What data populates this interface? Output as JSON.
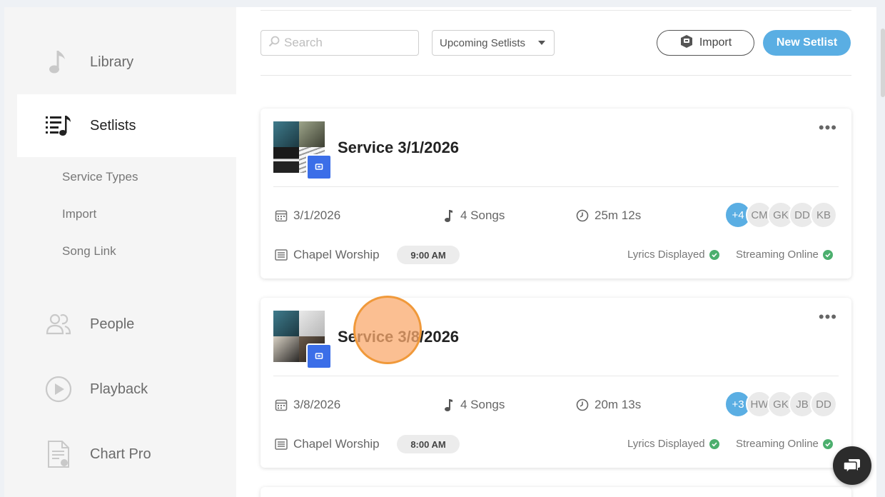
{
  "sidebar": {
    "items": [
      {
        "label": "Library",
        "icon": "music-note-icon"
      },
      {
        "label": "Setlists",
        "icon": "setlist-icon"
      },
      {
        "label": "People",
        "icon": "people-icon"
      },
      {
        "label": "Playback",
        "icon": "play-circle-icon"
      },
      {
        "label": "Chart Pro",
        "icon": "chart-document-icon"
      }
    ],
    "sub_items": [
      "Service Types",
      "Import",
      "Song Link"
    ]
  },
  "toolbar": {
    "search_placeholder": "Search",
    "filter_selected": "Upcoming Setlists",
    "import_label": "Import",
    "new_label": "New Setlist"
  },
  "setlists": [
    {
      "title": "Service 3/1/2026",
      "date": "3/1/2026",
      "songs": "4 Songs",
      "duration": "25m 12s",
      "service_type": "Chapel Worship",
      "time": "9:00 AM",
      "people_more": "+4",
      "people": [
        "CM",
        "GK",
        "DD",
        "KB"
      ],
      "lyrics_status": "Lyrics Displayed",
      "streaming_status": "Streaming Online"
    },
    {
      "title": "Service 3/8/2026",
      "date": "3/8/2026",
      "songs": "4 Songs",
      "duration": "20m 13s",
      "service_type": "Chapel Worship",
      "time": "8:00 AM",
      "people_more": "+3",
      "people": [
        "HW",
        "GK",
        "JB",
        "DD"
      ],
      "lyrics_status": "Lyrics Displayed",
      "streaming_status": "Streaming Online"
    }
  ],
  "colors": {
    "accent": "#5aaee3",
    "success": "#4caf6e",
    "sidebar_bg": "#f5f5f5"
  }
}
